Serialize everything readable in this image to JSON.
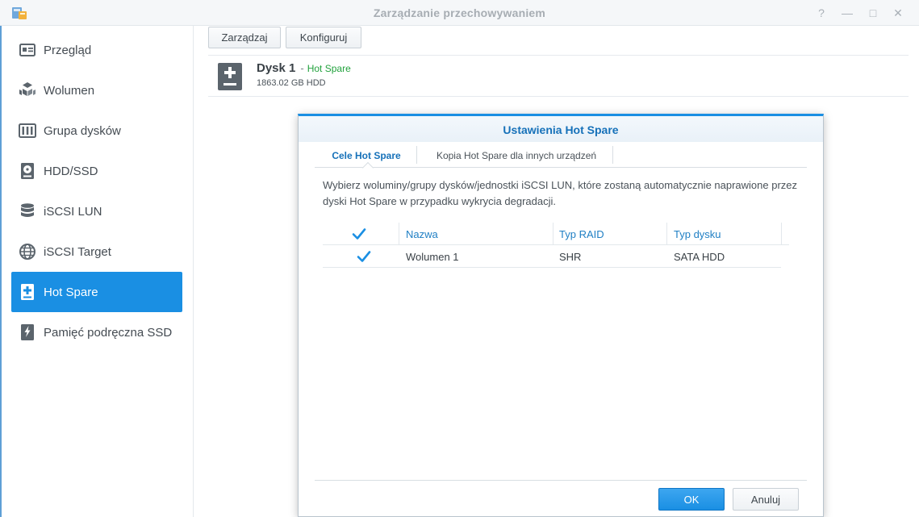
{
  "window": {
    "title": "Zarządzanie przechowywaniem",
    "controls": {
      "help": "?",
      "minimize": "—",
      "maximize": "□",
      "close": "✕"
    }
  },
  "sidebar": {
    "items": [
      {
        "label": "Przegląd",
        "icon": "overview-icon",
        "active": false
      },
      {
        "label": "Wolumen",
        "icon": "volume-icon",
        "active": false
      },
      {
        "label": "Grupa dysków",
        "icon": "disk-group-icon",
        "active": false
      },
      {
        "label": "HDD/SSD",
        "icon": "hdd-icon",
        "active": false
      },
      {
        "label": "iSCSI LUN",
        "icon": "database-icon",
        "active": false
      },
      {
        "label": "iSCSI Target",
        "icon": "globe-icon",
        "active": false
      },
      {
        "label": "Hot Spare",
        "icon": "hot-spare-icon",
        "active": true
      },
      {
        "label": "Pamięć podręczna SSD",
        "icon": "ssd-cache-icon",
        "active": false
      }
    ]
  },
  "toolbar": {
    "manage_label": "Zarządzaj",
    "configure_label": "Konfiguruj"
  },
  "disk": {
    "name": "Dysk 1",
    "separator": "-",
    "status": "Hot Spare",
    "size": "1863.02 GB HDD"
  },
  "dialog": {
    "title": "Ustawienia Hot Spare",
    "tabs": [
      {
        "label": "Cele Hot Spare",
        "active": true
      },
      {
        "label": "Kopia Hot Spare dla innych urządzeń",
        "active": false
      }
    ],
    "description": "Wybierz woluminy/grupy dysków/jednostki iSCSI LUN, które zostaną automatycznie naprawione przez dyski Hot Spare w przypadku wykrycia degradacji.",
    "table": {
      "columns": [
        "Nazwa",
        "Typ RAID",
        "Typ dysku"
      ],
      "header_checked": true,
      "rows": [
        {
          "checked": true,
          "name": "Wolumen 1",
          "raid": "SHR",
          "disk_type": "SATA HDD"
        }
      ]
    },
    "ok_label": "OK",
    "cancel_label": "Anuluj"
  },
  "colors": {
    "accent": "#1a8fe3",
    "status_green": "#22a23d",
    "link_blue": "#1f7fc4"
  }
}
